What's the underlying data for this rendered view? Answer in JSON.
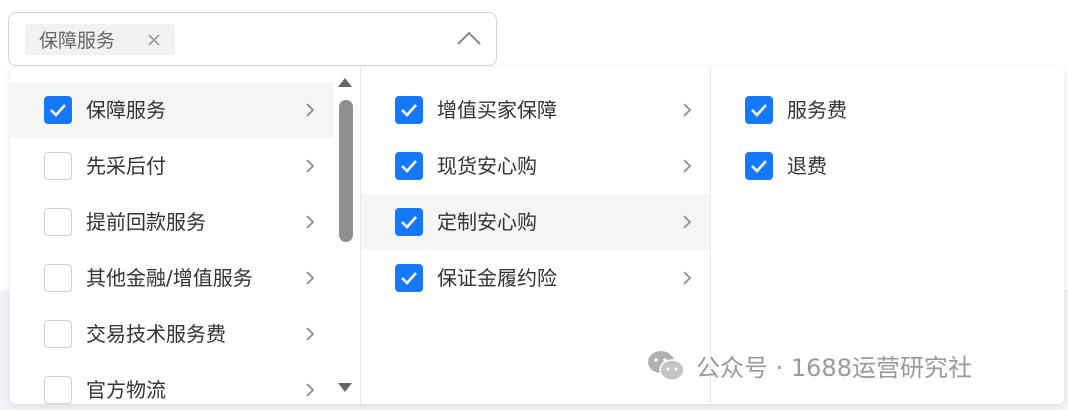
{
  "select": {
    "tags": [
      {
        "label": "保障服务"
      }
    ]
  },
  "columns": [
    {
      "items": [
        {
          "label": "保障服务",
          "checked": true,
          "active": true
        },
        {
          "label": "先采后付",
          "checked": false,
          "active": false
        },
        {
          "label": "提前回款服务",
          "checked": false,
          "active": false
        },
        {
          "label": "其他金融/增值服务",
          "checked": false,
          "active": false
        },
        {
          "label": "交易技术服务费",
          "checked": false,
          "active": false
        },
        {
          "label": "官方物流",
          "checked": false,
          "active": false
        }
      ]
    },
    {
      "items": [
        {
          "label": "增值买家保障",
          "checked": true,
          "active": false
        },
        {
          "label": "现货安心购",
          "checked": true,
          "active": false
        },
        {
          "label": "定制安心购",
          "checked": true,
          "active": true
        },
        {
          "label": "保证金履约险",
          "checked": true,
          "active": false
        }
      ]
    },
    {
      "items": [
        {
          "label": "服务费",
          "checked": true
        },
        {
          "label": "退费",
          "checked": true
        }
      ]
    }
  ],
  "watermark": {
    "text": "公众号 · 1688运营研究社"
  },
  "colors": {
    "accent": "#1677ff",
    "active_row": "#f5f5f5",
    "scroll_thumb": "#8f8f8f"
  }
}
